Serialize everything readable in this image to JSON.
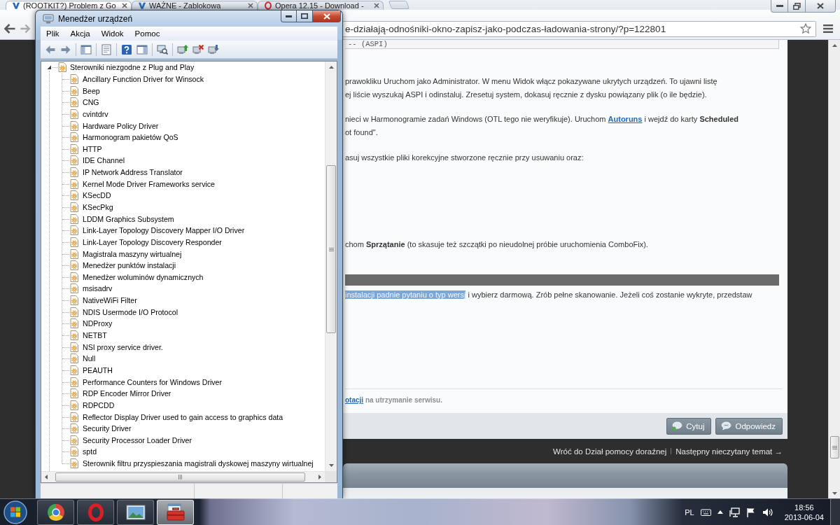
{
  "browser": {
    "tabs": [
      {
        "title": "(ROOTKIT?) Problem z Go",
        "kind": "forum",
        "selected": true
      },
      {
        "title": "WAŻNE - Zablokowa",
        "kind": "forum",
        "selected": false
      },
      {
        "title": "Opera 12.15 - Download -",
        "kind": "opera",
        "selected": false
      }
    ],
    "address": "e-działają-odnośniki-okno-zapisz-jako-podczas-ładowania-strony/?p=122801",
    "post": {
      "blocks": [
        {
          "kind": "code",
          "lines": [
            [
              {
                "kind": "text",
                "text": "-- (ASPI)"
              }
            ]
          ]
        },
        {
          "kind": "paragraph",
          "lines": [
            [
              {
                "kind": "text",
                "text": "prawokliku Uruchom jako Administrator. W menu Widok włącz pokazywane ukrytych urządzeń. To ujawni listę"
              }
            ],
            [
              {
                "kind": "text",
                "text": "ej liście wyszukaj ASPI i odinstaluj. Zresetuj system, dokasuj ręcznie z dysku powiązany plik (o ile będzie)."
              }
            ]
          ]
        },
        {
          "kind": "paragraph",
          "lines": [
            [
              {
                "kind": "text",
                "text": "nieci w Harmonogramie zadań Windows (OTL tego nie weryfikuje). Uruchom "
              },
              {
                "kind": "link",
                "text": "Autoruns"
              },
              {
                "kind": "text",
                "text": " i wejdź do karty **Scheduled**"
              }
            ],
            [
              {
                "kind": "text",
                "text": "ot found\"."
              }
            ]
          ]
        },
        {
          "kind": "paragraph",
          "lines": [
            [
              {
                "kind": "text",
                "text": "asuj wszystkie pliki korekcyjne stworzone ręcznie przy usuwaniu oraz:"
              }
            ]
          ]
        },
        {
          "kind": "paragraph",
          "lines": [
            [
              {
                "kind": "text",
                "text": "chom **Sprzątanie** (to skasuje też szczątki po nieudolnej próbie uruchomienia ComboFix)."
              }
            ]
          ]
        },
        {
          "kind": "bar"
        },
        {
          "kind": "paragraph",
          "lines": [
            [
              {
                "kind": "highlight",
                "text": "instalacji padnie pytaniu o typ wersj"
              },
              {
                "kind": "text",
                "text": " i wybierz darmową. Zrób pełne skanowanie. Jeżeli coś zostanie wykryte, przedstaw"
              }
            ]
          ]
        }
      ],
      "signature": [
        {
          "kind": "link",
          "text": "otacji"
        },
        {
          "kind": "text",
          "text": " na utrzymanie serwisu."
        }
      ],
      "buttons": [
        {
          "label": "Cytuj",
          "kind": "quote"
        },
        {
          "label": "Odpowiedz",
          "kind": "reply"
        }
      ]
    },
    "nav_links": [
      "Wróć do Dział pomocy doraźnej",
      "Następny nieczytany temat →"
    ]
  },
  "device_manager": {
    "title": "Menedżer urządzeń",
    "menu": [
      "Plik",
      "Akcja",
      "Widok",
      "Pomoc"
    ],
    "tree": [
      {
        "label": "Sterowniki niezgodne z Plug and Play",
        "expanded": true,
        "children": [
          {
            "label": "Ancillary Function Driver for Winsock"
          },
          {
            "label": "Beep"
          },
          {
            "label": "CNG"
          },
          {
            "label": "cvintdrv"
          },
          {
            "label": "Hardware Policy Driver"
          },
          {
            "label": "Harmonogram pakietów QoS"
          },
          {
            "label": "HTTP"
          },
          {
            "label": "IDE Channel"
          },
          {
            "label": "IP Network Address Translator"
          },
          {
            "label": "Kernel Mode Driver Frameworks service"
          },
          {
            "label": "KSecDD"
          },
          {
            "label": "KSecPkg"
          },
          {
            "label": "LDDM Graphics Subsystem"
          },
          {
            "label": "Link-Layer Topology Discovery Mapper I/O Driver"
          },
          {
            "label": "Link-Layer Topology Discovery Responder"
          },
          {
            "label": "Magistrala maszyny wirtualnej"
          },
          {
            "label": "Menedżer punktów instalacji"
          },
          {
            "label": "Menedżer woluminów dynamicznych"
          },
          {
            "label": "msisadrv"
          },
          {
            "label": "NativeWiFi Filter"
          },
          {
            "label": "NDIS Usermode I/O Protocol"
          },
          {
            "label": "NDProxy"
          },
          {
            "label": "NETBT"
          },
          {
            "label": "NSI proxy service driver."
          },
          {
            "label": "Null"
          },
          {
            "label": "PEAUTH"
          },
          {
            "label": "Performance Counters for Windows Driver"
          },
          {
            "label": "RDP Encoder Mirror Driver"
          },
          {
            "label": "RDPCDD"
          },
          {
            "label": "Reflector Display Driver used to gain access to graphics data"
          },
          {
            "label": "Security Driver"
          },
          {
            "label": "Security Processor Loader Driver"
          },
          {
            "label": "sptd"
          },
          {
            "label": "Sterownik filtru przyspieszania magistrali dyskowej maszyny wirtualnej"
          }
        ]
      }
    ]
  },
  "taskbar": {
    "apps": [
      {
        "kind": "chrome",
        "selected": false
      },
      {
        "kind": "opera",
        "selected": false
      },
      {
        "kind": "pictures",
        "selected": false
      },
      {
        "kind": "toolbox",
        "selected": true
      }
    ],
    "language": "PL",
    "time": "18:56",
    "date": "2013-06-04"
  }
}
